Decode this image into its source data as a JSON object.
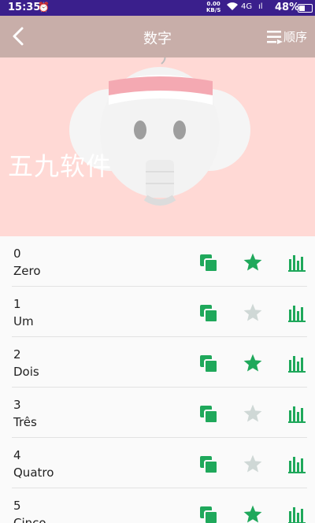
{
  "status": {
    "time": "15:35",
    "speed_value": "0.00",
    "speed_unit": "KB/S",
    "sig1": "4G",
    "sig2": "ıl",
    "battery": "48%",
    "battery_level": 0.48
  },
  "header": {
    "title": "数字",
    "sort_label": "顺序"
  },
  "hero": {
    "watermark": "五九软件"
  },
  "colors": {
    "accent": "#1fa85b",
    "star_off": "#cfd8d6",
    "appbar": "#c8aea9",
    "hero_bg": "#ffd9d5",
    "status_bar": "#3a1f8c"
  },
  "items": [
    {
      "number": "0",
      "word": "Zero",
      "starred": true
    },
    {
      "number": "1",
      "word": "Um",
      "starred": false
    },
    {
      "number": "2",
      "word": "Dois",
      "starred": true
    },
    {
      "number": "3",
      "word": "Três",
      "starred": false
    },
    {
      "number": "4",
      "word": "Quatro",
      "starred": false
    },
    {
      "number": "5",
      "word": "Cinco",
      "starred": true
    }
  ]
}
